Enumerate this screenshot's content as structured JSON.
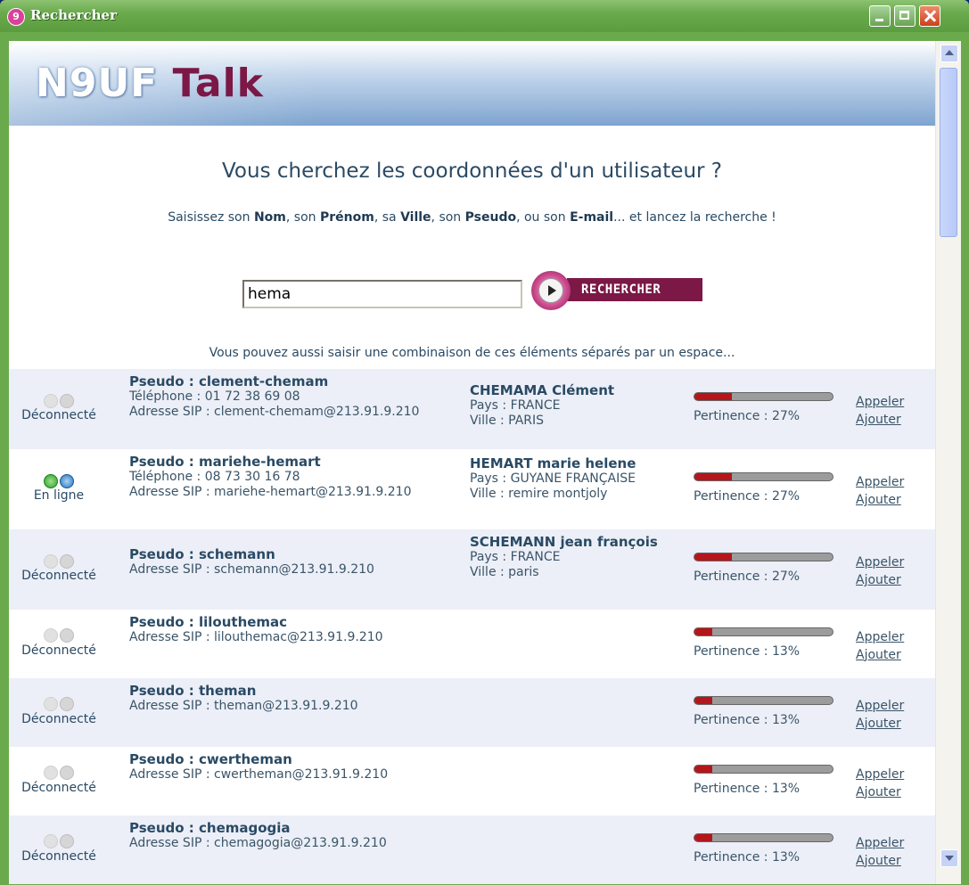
{
  "window": {
    "title": "Rechercher"
  },
  "banner": {
    "logo_brand": "N9UF",
    "logo_product": "Talk"
  },
  "page": {
    "headline": "Vous cherchez les coordonnées d'un utilisateur ?",
    "instructions": {
      "prefix": "Saisissez son ",
      "nom": "Nom",
      "sep1": ", son ",
      "prenom": "Prénom",
      "sep2": ", sa ",
      "ville": "Ville",
      "sep3": ", son ",
      "pseudo": "Pseudo",
      "sep4": ", ou son ",
      "email": "E-mail",
      "suffix": "... et lancez la recherche !"
    },
    "search": {
      "value": "hema",
      "button_label": "RECHERCHER"
    },
    "hint": "Vous pouvez aussi saisir une combinaison de ces éléments séparés par un espace..."
  },
  "colors": {
    "brand": "#7b1846",
    "relevance_fill": "#b3171c",
    "row_alt": "#eceff7",
    "text": "#2a4a64"
  },
  "results": [
    {
      "status": "Déconnecté",
      "online": false,
      "pseudo": "Pseudo : clement-chemam",
      "phone": "Téléphone : 01 72 38 69 08",
      "sip": "Adresse SIP : clement-chemam@213.91.9.210",
      "fullname": "CHEMAMA Clément",
      "pays": "Pays : FRANCE",
      "ville": "Ville : PARIS",
      "relevance": 27,
      "relevance_label": "Pertinence : 27%",
      "call": "Appeler",
      "add": "Ajouter"
    },
    {
      "status": "En ligne",
      "online": true,
      "pseudo": "Pseudo : mariehe-hemart",
      "phone": "Téléphone : 08 73 30 16 78",
      "sip": "Adresse SIP : mariehe-hemart@213.91.9.210",
      "fullname": "HEMART marie helene",
      "pays": "Pays : GUYANE FRANÇAISE",
      "ville": "Ville : remire montjoly",
      "relevance": 27,
      "relevance_label": "Pertinence : 27%",
      "call": "Appeler",
      "add": "Ajouter"
    },
    {
      "status": "Déconnecté",
      "online": false,
      "pseudo": "Pseudo : schemann",
      "phone": "",
      "sip": "Adresse SIP : schemann@213.91.9.210",
      "fullname": "SCHEMANN jean françois",
      "pays": "Pays : FRANCE",
      "ville": "Ville : paris",
      "relevance": 27,
      "relevance_label": "Pertinence : 27%",
      "call": "Appeler",
      "add": "Ajouter"
    },
    {
      "status": "Déconnecté",
      "online": false,
      "pseudo": "Pseudo : lilouthemac",
      "phone": "",
      "sip": "Adresse SIP : lilouthemac@213.91.9.210",
      "fullname": "",
      "pays": "",
      "ville": "",
      "relevance": 13,
      "relevance_label": "Pertinence : 13%",
      "call": "Appeler",
      "add": "Ajouter"
    },
    {
      "status": "Déconnecté",
      "online": false,
      "pseudo": "Pseudo : theman",
      "phone": "",
      "sip": "Adresse SIP : theman@213.91.9.210",
      "fullname": "",
      "pays": "",
      "ville": "",
      "relevance": 13,
      "relevance_label": "Pertinence : 13%",
      "call": "Appeler",
      "add": "Ajouter"
    },
    {
      "status": "Déconnecté",
      "online": false,
      "pseudo": "Pseudo : cwertheman",
      "phone": "",
      "sip": "Adresse SIP : cwertheman@213.91.9.210",
      "fullname": "",
      "pays": "",
      "ville": "",
      "relevance": 13,
      "relevance_label": "Pertinence : 13%",
      "call": "Appeler",
      "add": "Ajouter"
    },
    {
      "status": "Déconnecté",
      "online": false,
      "pseudo": "Pseudo : chemagogia",
      "phone": "",
      "sip": "Adresse SIP : chemagogia@213.91.9.210",
      "fullname": "",
      "pays": "",
      "ville": "",
      "relevance": 13,
      "relevance_label": "Pertinence : 13%",
      "call": "Appeler",
      "add": "Ajouter"
    }
  ]
}
